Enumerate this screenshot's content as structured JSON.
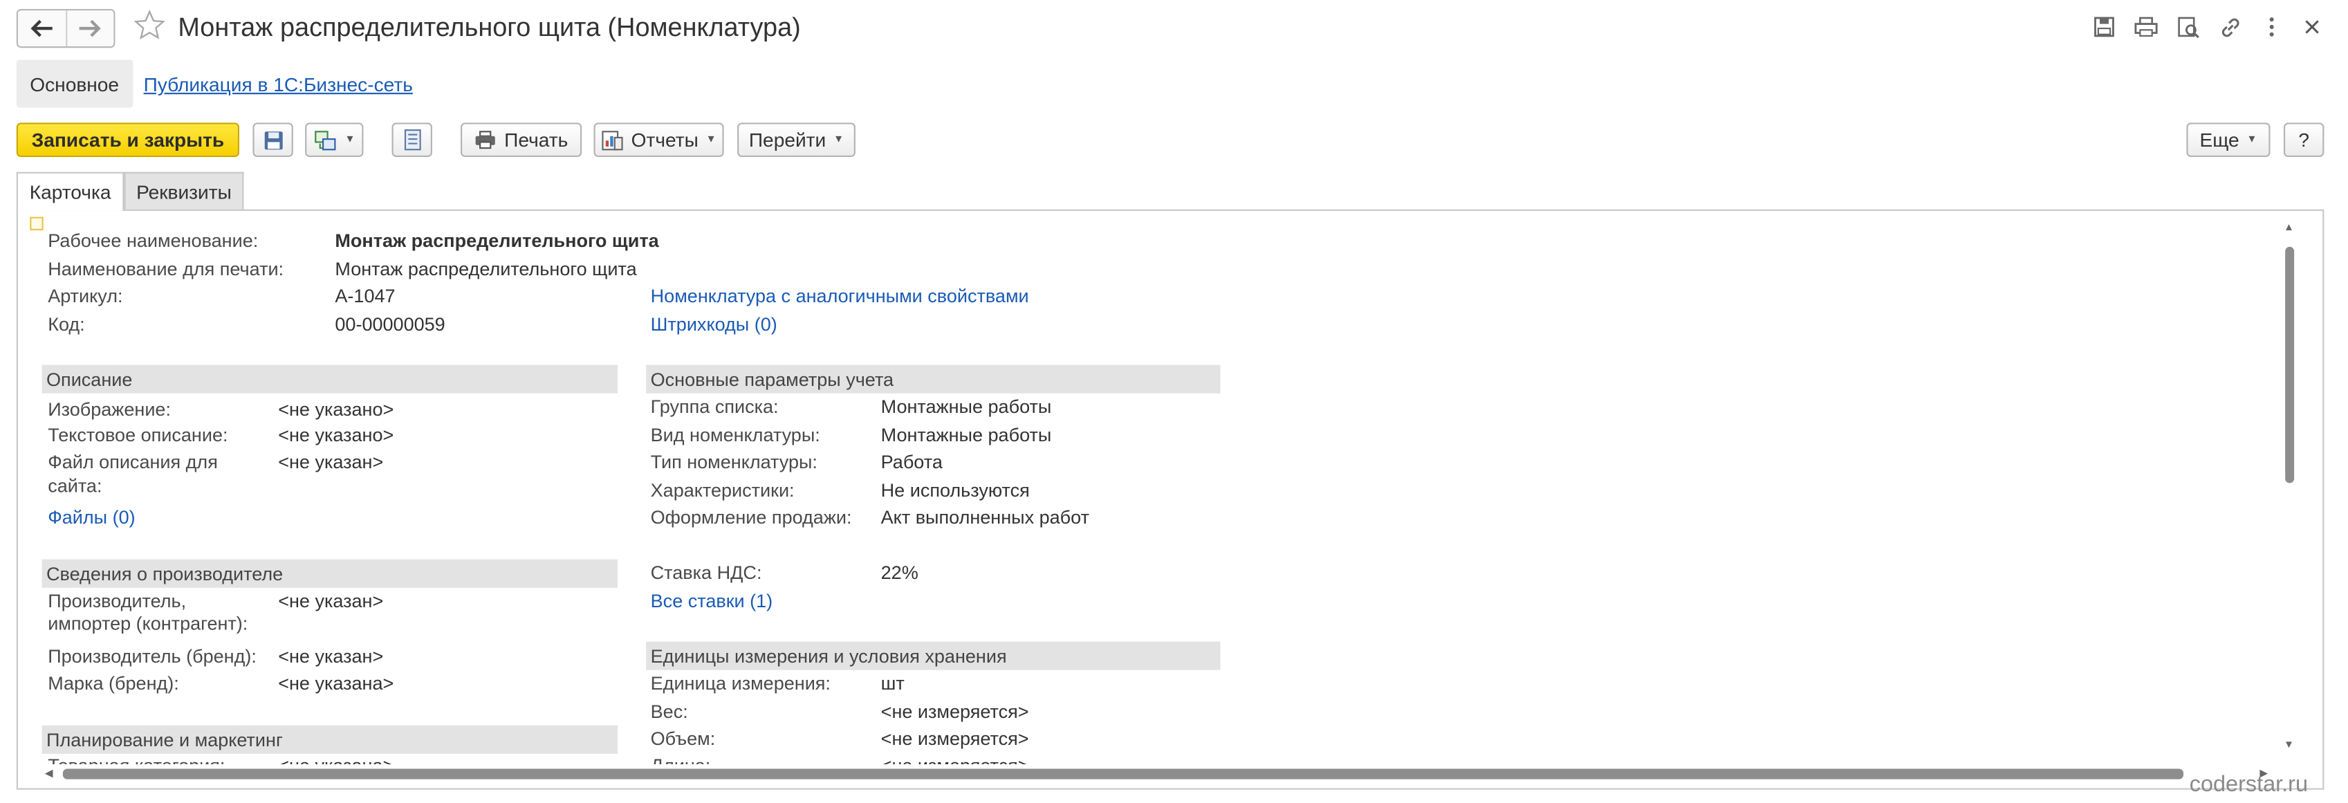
{
  "window": {
    "title": "Монтаж распределительного щита (Номенклатура)"
  },
  "sections": {
    "main": "Основное",
    "publish_link": "Публикация в 1С:Бизнес-сеть"
  },
  "toolbar": {
    "save_close": "Записать и закрыть",
    "print": "Печать",
    "reports": "Отчеты",
    "goto": "Перейти",
    "more": "Еще",
    "help": "?"
  },
  "tabs": [
    "Карточка",
    "Реквизиты"
  ],
  "card": {
    "header": {
      "work_name_label": "Рабочее наименование:",
      "work_name_value": "Монтаж распределительного щита",
      "print_name_label": "Наименование для печати:",
      "print_name_value": "Монтаж распределительного щита",
      "article_label": "Артикул:",
      "article_value": "А-1047",
      "code_label": "Код:",
      "code_value": "00-00000059",
      "similar_link": "Номенклатура с аналогичными свойствами",
      "barcodes_link": "Штрихкоды (0)"
    },
    "description": {
      "title": "Описание",
      "image_label": "Изображение:",
      "image_value": "<не указано>",
      "text_label": "Текстовое описание:",
      "text_value": "<не указано>",
      "file_label_1": "Файл описания для",
      "file_label_2": "сайта:",
      "file_value": "<не указан>",
      "files_link": "Файлы (0)"
    },
    "manufacturer": {
      "title": "Сведения о производителе",
      "producer_label_1": "Производитель,",
      "producer_label_2": "импортер (контрагент):",
      "producer_value": "<не указан>",
      "brand_label": "Производитель (бренд):",
      "brand_value": "<не указан>",
      "mark_label": "Марка (бренд):",
      "mark_value": "<не указана>"
    },
    "planning": {
      "title": "Планирование и маркетинг",
      "category_label": "Товарная категория:",
      "category_value": "<не указана>"
    },
    "accounting": {
      "title": "Основные параметры учета",
      "list_group_label": "Группа списка:",
      "list_group_value": "Монтажные работы",
      "kind_label": "Вид номенклатуры:",
      "kind_value": "Монтажные работы",
      "type_label": "Тип номенклатуры:",
      "type_value": "Работа",
      "chars_label": "Характеристики:",
      "chars_value": "Не используются",
      "sale_label": "Оформление продажи:",
      "sale_value": "Акт выполненных работ",
      "vat_label": "Ставка НДС:",
      "vat_value": "22%",
      "all_rates_link": "Все ставки (1)"
    },
    "units": {
      "title": "Единицы измерения и условия хранения",
      "unit_label": "Единица измерения:",
      "unit_value": "шт",
      "weight_label": "Вес:",
      "weight_value": "<не измеряется>",
      "volume_label": "Объем:",
      "volume_value": "<не измеряется>",
      "length_label": "Длина:",
      "length_value": "<не измеряется>"
    }
  },
  "watermark": "coderstar.ru",
  "colors": {
    "primary_button": "#f5d000",
    "link": "#1a5bb5",
    "group_header": "#e3e3e3"
  },
  "icons": [
    "back-arrow-icon",
    "forward-arrow-icon",
    "star-icon",
    "save-icon",
    "print-icon",
    "preview-icon",
    "link-icon",
    "more-vertical-icon",
    "close-icon",
    "disk-icon",
    "structure-icon",
    "list-icon",
    "printer-icon",
    "reports-icon"
  ]
}
